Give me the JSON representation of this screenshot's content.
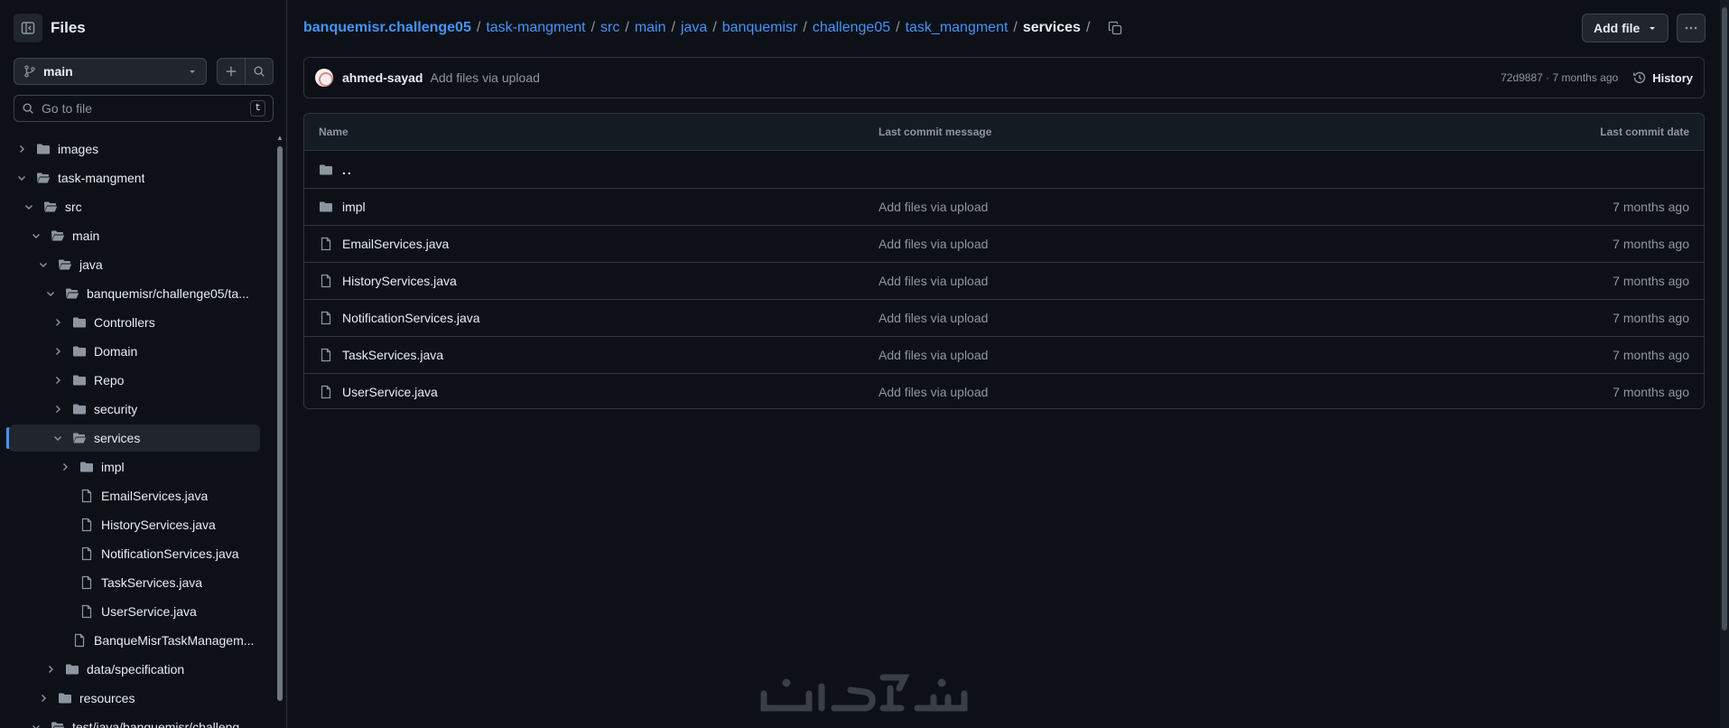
{
  "sidebar": {
    "title": "Files",
    "branch": "main",
    "go_to_file_placeholder": "Go to file",
    "go_to_file_shortcut": "t",
    "tree": [
      {
        "name": "images",
        "type": "folder",
        "depth": 0,
        "expanded": false
      },
      {
        "name": "task-mangment",
        "type": "folder",
        "depth": 0,
        "expanded": true
      },
      {
        "name": "src",
        "type": "folder",
        "depth": 1,
        "expanded": true
      },
      {
        "name": "main",
        "type": "folder",
        "depth": 2,
        "expanded": true
      },
      {
        "name": "java",
        "type": "folder",
        "depth": 3,
        "expanded": true
      },
      {
        "name": "banquemisr/challenge05/ta...",
        "type": "folder",
        "depth": 4,
        "expanded": true
      },
      {
        "name": "Controllers",
        "type": "folder",
        "depth": 5,
        "expanded": false
      },
      {
        "name": "Domain",
        "type": "folder",
        "depth": 5,
        "expanded": false
      },
      {
        "name": "Repo",
        "type": "folder",
        "depth": 5,
        "expanded": false
      },
      {
        "name": "security",
        "type": "folder",
        "depth": 5,
        "expanded": false
      },
      {
        "name": "services",
        "type": "folder",
        "depth": 5,
        "expanded": true,
        "active": true
      },
      {
        "name": "impl",
        "type": "folder",
        "depth": 6,
        "expanded": false
      },
      {
        "name": "EmailServices.java",
        "type": "file",
        "depth": 6
      },
      {
        "name": "HistoryServices.java",
        "type": "file",
        "depth": 6
      },
      {
        "name": "NotificationServices.java",
        "type": "file",
        "depth": 6
      },
      {
        "name": "TaskServices.java",
        "type": "file",
        "depth": 6
      },
      {
        "name": "UserService.java",
        "type": "file",
        "depth": 6
      },
      {
        "name": "BanqueMisrTaskManagem...",
        "type": "file",
        "depth": 5
      },
      {
        "name": "data/specification",
        "type": "folder",
        "depth": 4,
        "expanded": false
      },
      {
        "name": "resources",
        "type": "folder",
        "depth": 3,
        "expanded": false
      },
      {
        "name": "test/java/banquemisr/challeng...",
        "type": "folder",
        "depth": 2,
        "expanded": true
      }
    ]
  },
  "breadcrumb": {
    "root": "banquemisr.challenge05",
    "parts": [
      "task-mangment",
      "src",
      "main",
      "java",
      "banquemisr",
      "challenge05",
      "task_mangment"
    ],
    "current": "services",
    "separator": "/"
  },
  "actions": {
    "add_file": "Add file"
  },
  "commit": {
    "author": "ahmed-sayad",
    "message": "Add files via upload",
    "sha_age": "72d9887 · 7 months ago",
    "history_label": "History"
  },
  "table": {
    "headers": {
      "name": "Name",
      "message": "Last commit message",
      "date": "Last commit date"
    },
    "parent_label": "..",
    "rows": [
      {
        "name": "impl",
        "type": "folder",
        "message": "Add files via upload",
        "date": "7 months ago"
      },
      {
        "name": "EmailServices.java",
        "type": "file",
        "message": "Add files via upload",
        "date": "7 months ago"
      },
      {
        "name": "HistoryServices.java",
        "type": "file",
        "message": "Add files via upload",
        "date": "7 months ago"
      },
      {
        "name": "NotificationServices.java",
        "type": "file",
        "message": "Add files via upload",
        "date": "7 months ago"
      },
      {
        "name": "TaskServices.java",
        "type": "file",
        "message": "Add files via upload",
        "date": "7 months ago"
      },
      {
        "name": "UserService.java",
        "type": "file",
        "message": "Add files via upload",
        "date": "7 months ago"
      }
    ]
  },
  "colors": {
    "background": "#0d1117",
    "link": "#4493f8",
    "border": "#30363d",
    "muted": "#8d96a0"
  }
}
